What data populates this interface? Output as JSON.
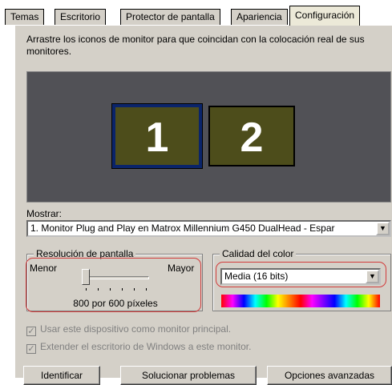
{
  "tabs": [
    {
      "label": "Temas"
    },
    {
      "label": "Escritorio"
    },
    {
      "label": "Protector de pantalla"
    },
    {
      "label": "Apariencia"
    },
    {
      "label": "Configuración",
      "active": true
    }
  ],
  "instruction": "Arrastre los iconos de monitor para que coincidan con la colocación real de sus monitores.",
  "monitors": [
    {
      "number": "1",
      "selected": true
    },
    {
      "number": "2",
      "selected": false
    }
  ],
  "display": {
    "label": "Mostrar:",
    "value": "1. Monitor Plug and Play en Matrox Millennium G450 DualHead - Espar"
  },
  "resolution": {
    "title": "Resolución de pantalla",
    "min_label": "Menor",
    "max_label": "Mayor",
    "value_text": "800 por 600 píxeles"
  },
  "color_quality": {
    "title": "Calidad del color",
    "value": "Media (16 bits)"
  },
  "checkboxes": [
    {
      "label": "Usar este dispositivo como monitor principal.",
      "checked": true,
      "enabled": false
    },
    {
      "label": "Extender el escritorio de Windows a este monitor.",
      "checked": true,
      "enabled": false
    }
  ],
  "buttons": {
    "identify": "Identificar",
    "troubleshoot": "Solucionar problemas",
    "advanced": "Opciones avanzadas"
  },
  "colors": {
    "face": "#d4d0c8",
    "monitor_area": "#515156",
    "monitor_fill": "#4d4d1b",
    "highlight_outline": "#d23b3b"
  }
}
